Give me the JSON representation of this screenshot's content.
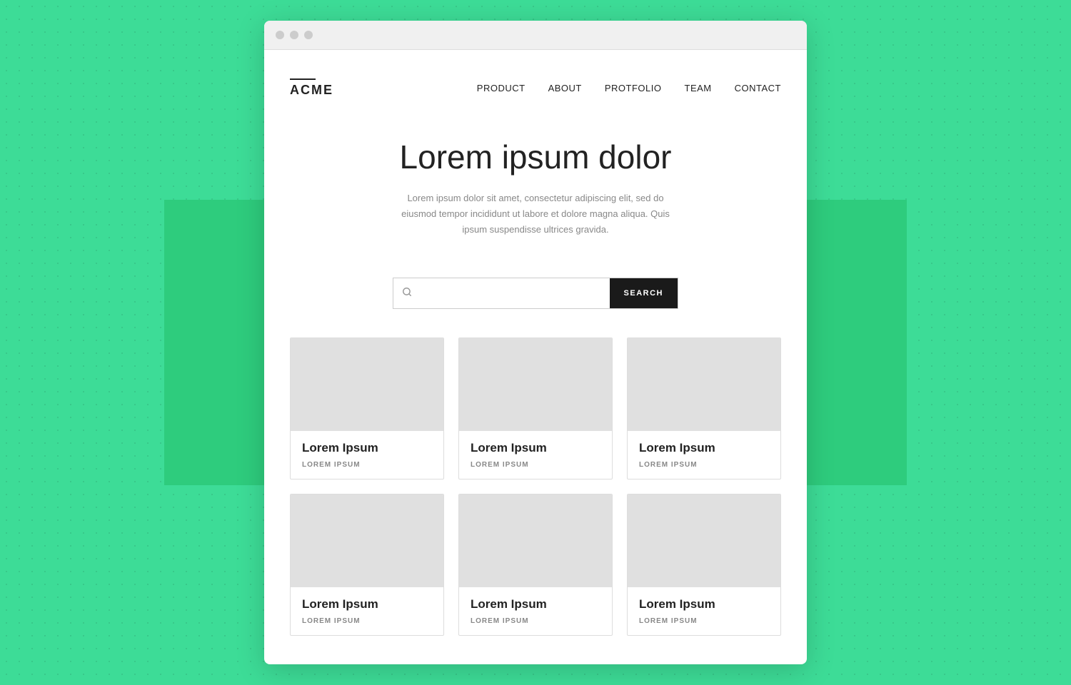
{
  "background": {
    "color": "#3ddc97"
  },
  "browser": {
    "dots": [
      "dot1",
      "dot2",
      "dot3"
    ]
  },
  "nav": {
    "logo": "ACME",
    "links": [
      {
        "label": "PRODUCT",
        "id": "product"
      },
      {
        "label": "ABOUT",
        "id": "about"
      },
      {
        "label": "PROTFOLIO",
        "id": "protfolio"
      },
      {
        "label": "TEAM",
        "id": "team"
      },
      {
        "label": "CONTACT",
        "id": "contact"
      }
    ]
  },
  "hero": {
    "title": "Lorem ipsum dolor",
    "subtitle": "Lorem ipsum dolor sit amet, consectetur adipiscing elit, sed do eiusmod tempor incididunt ut labore et dolore magna aliqua. Quis ipsum suspendisse ultrices gravida."
  },
  "search": {
    "placeholder": "",
    "button_label": "SEARCH",
    "icon": "🔍"
  },
  "cards": [
    {
      "title": "Lorem Ipsum",
      "subtitle": "LOREM IPSUM"
    },
    {
      "title": "Lorem Ipsum",
      "subtitle": "LOREM IPSUM"
    },
    {
      "title": "Lorem Ipsum",
      "subtitle": "LOREM IPSUM"
    },
    {
      "title": "Lorem Ipsum",
      "subtitle": "LOREM IPSUM"
    },
    {
      "title": "Lorem Ipsum",
      "subtitle": "LOREM IPSUM"
    },
    {
      "title": "Lorem Ipsum",
      "subtitle": "LOREM IPSUM"
    }
  ]
}
